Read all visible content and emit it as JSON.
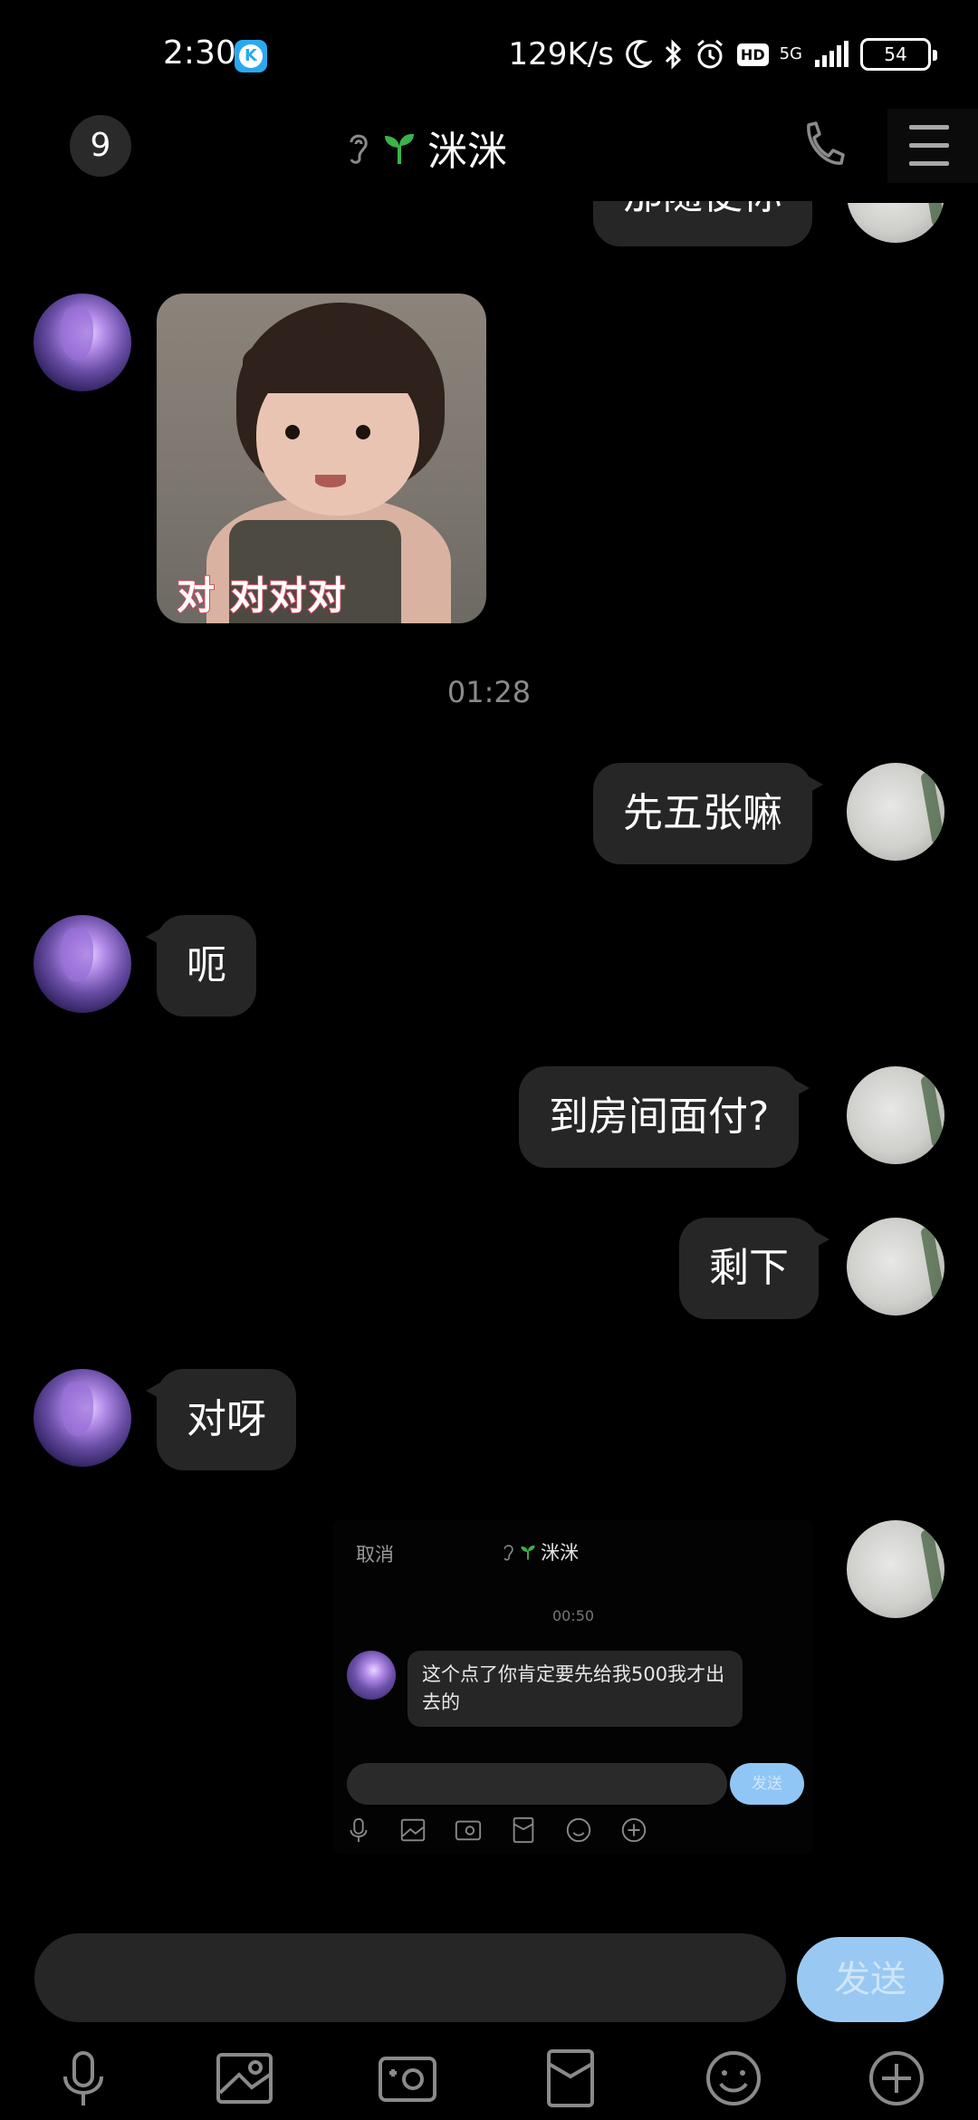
{
  "status_bar": {
    "time": "2:30",
    "speed": "129K/s",
    "hd": "HD",
    "network": "5G",
    "battery": "54"
  },
  "header": {
    "unread_count": "9",
    "contact_name": "洣洣"
  },
  "messages": {
    "m1_partial": "那随便你",
    "sticker_caption": "对 对对对",
    "timestamp": "01:28",
    "m2": "先五张嘛",
    "m3": "呃",
    "m4": "到房间面付?",
    "m5": "剩下",
    "m6": "对呀"
  },
  "embedded_screenshot": {
    "cancel": "取消",
    "contact_name": "洣洣",
    "timestamp": "00:50",
    "message": "这个点了你肯定要先给我500我才出去的",
    "send_label": "发送"
  },
  "composer": {
    "send_label": "发送"
  },
  "toolbar_icons": [
    "mic-icon",
    "image-icon",
    "camera-icon",
    "red-envelope-icon",
    "emoji-icon",
    "plus-icon"
  ],
  "colors": {
    "background": "#000000",
    "bubble": "#262626",
    "send_button": "#99c9f2",
    "sprout": "#3bb34a"
  }
}
